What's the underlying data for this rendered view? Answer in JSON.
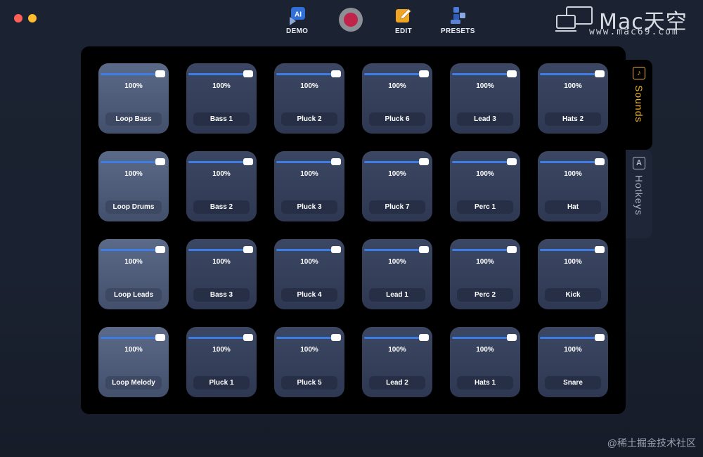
{
  "window": {
    "controls": [
      "close",
      "minimize"
    ]
  },
  "toolbar": {
    "demo_label": "DEMO",
    "ai_badge": "AI",
    "edit_label": "EDIT",
    "presets_label": "PRESETS"
  },
  "brand": {
    "main": "Mac天空",
    "sub": "www.mac69.com"
  },
  "tabs": {
    "sounds": "Sounds",
    "hotkeys": "Hotkeys",
    "hotkeys_icon_letter": "A"
  },
  "pads": [
    {
      "label": "Loop Bass",
      "volume": "100%",
      "loop": true
    },
    {
      "label": "Bass 1",
      "volume": "100%"
    },
    {
      "label": "Pluck 2",
      "volume": "100%"
    },
    {
      "label": "Pluck 6",
      "volume": "100%"
    },
    {
      "label": "Lead 3",
      "volume": "100%"
    },
    {
      "label": "Hats 2",
      "volume": "100%"
    },
    {
      "label": "Loop Drums",
      "volume": "100%",
      "loop": true
    },
    {
      "label": "Bass 2",
      "volume": "100%"
    },
    {
      "label": "Pluck 3",
      "volume": "100%"
    },
    {
      "label": "Pluck 7",
      "volume": "100%"
    },
    {
      "label": "Perc 1",
      "volume": "100%"
    },
    {
      "label": "Hat",
      "volume": "100%"
    },
    {
      "label": "Loop Leads",
      "volume": "100%",
      "loop": true
    },
    {
      "label": "Bass 3",
      "volume": "100%"
    },
    {
      "label": "Pluck 4",
      "volume": "100%"
    },
    {
      "label": "Lead 1",
      "volume": "100%"
    },
    {
      "label": "Perc 2",
      "volume": "100%"
    },
    {
      "label": "Kick",
      "volume": "100%"
    },
    {
      "label": "Loop Melody",
      "volume": "100%",
      "loop": true
    },
    {
      "label": "Pluck 1",
      "volume": "100%"
    },
    {
      "label": "Pluck 5",
      "volume": "100%"
    },
    {
      "label": "Lead 2",
      "volume": "100%"
    },
    {
      "label": "Hats 1",
      "volume": "100%"
    },
    {
      "label": "Snare",
      "volume": "100%"
    }
  ],
  "watermark": "@稀土掘金技术社区",
  "colors": {
    "accent": "#3d7de6",
    "tab_active": "#f0b429",
    "record": "#c0244b"
  }
}
